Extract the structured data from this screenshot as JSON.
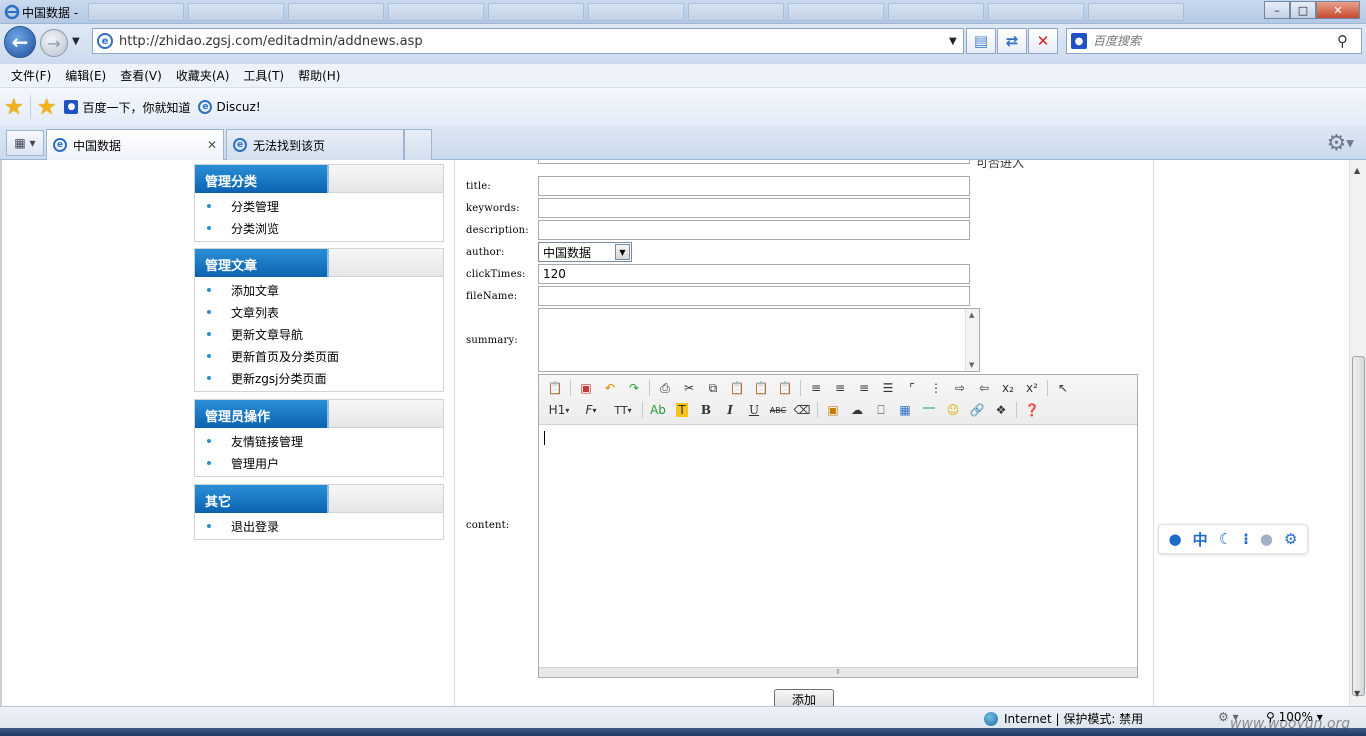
{
  "window": {
    "title": "中国数据 -"
  },
  "nav": {
    "url": "http://zhidao.zgsj.com/editadmin/addnews.asp",
    "search_placeholder": "百度搜索"
  },
  "menu": [
    "文件(F)",
    "编辑(E)",
    "查看(V)",
    "收藏夹(A)",
    "工具(T)",
    "帮助(H)"
  ],
  "favorites": [
    "百度一下，你就知道",
    "Discuz!"
  ],
  "tabs": [
    {
      "label": "中国数据",
      "active": true
    },
    {
      "label": "无法找到该页",
      "active": false
    }
  ],
  "sidebar": [
    {
      "title": "管理分类",
      "items": [
        "分类管理",
        "分类浏览"
      ]
    },
    {
      "title": "管理文章",
      "items": [
        "添加文章",
        "文章列表",
        "更新文章导航",
        "更新首页及分类页面",
        "更新zgsj分类页面"
      ]
    },
    {
      "title": "管理员操作",
      "items": [
        "友情链接管理",
        "管理用户"
      ]
    },
    {
      "title": "其它",
      "items": [
        "退出登录"
      ]
    }
  ],
  "form": {
    "peek_label": "可否进入",
    "labels": {
      "title": "title:",
      "keywords": "keywords:",
      "description": "description:",
      "author": "author:",
      "clickTimes": "clickTimes:",
      "fileName": "fileName:",
      "summary": "summary:",
      "content": "content:"
    },
    "values": {
      "title": "",
      "keywords": "",
      "description": "",
      "author": "中国数据",
      "clickTimes": "120",
      "fileName": "",
      "summary": ""
    },
    "submit_label": "添加"
  },
  "editor": {
    "row1_icons": [
      "source-icon",
      "fullscreen-icon",
      "undo-icon",
      "redo-icon",
      "print-icon",
      "cut-icon",
      "copy-icon",
      "paste-icon",
      "paste-text-icon",
      "paste-word-icon",
      "align-left-icon",
      "align-center-icon",
      "align-right-icon",
      "justify-icon",
      "ordered-list-icon",
      "unordered-list-icon",
      "indent-icon",
      "outdent-icon",
      "subscript-icon",
      "superscript-icon",
      "select-icon"
    ],
    "row2": {
      "heading": "H1",
      "font": "F",
      "size": "TT",
      "fore": "Ab",
      "back": "T",
      "bold": "B",
      "italic": "I",
      "underline": "U",
      "strike": "ABC"
    }
  },
  "float_toolbar_icons": [
    "paw-icon",
    "zh-icon",
    "moon-icon",
    "dots-icon",
    "user-icon",
    "gear-icon"
  ],
  "float_toolbar_text": "中",
  "status": {
    "zone": "Internet | 保护模式: 禁用",
    "zoom": "100%"
  },
  "watermark": "www.wooyun.org"
}
